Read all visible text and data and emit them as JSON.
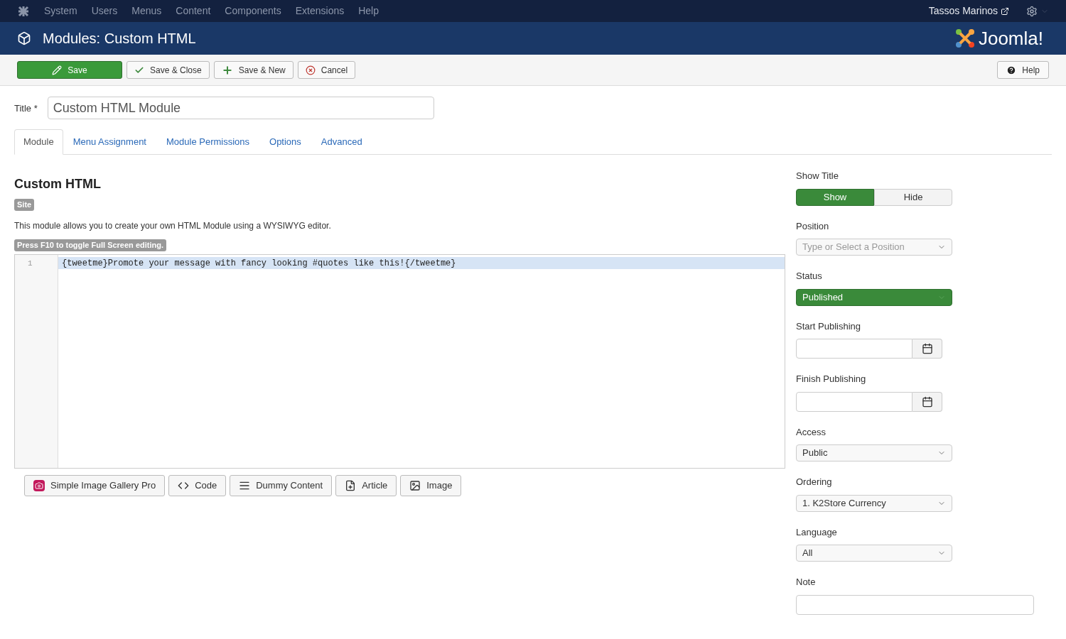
{
  "topbar": {
    "menu": [
      "System",
      "Users",
      "Menus",
      "Content",
      "Components",
      "Extensions",
      "Help"
    ],
    "user": "Tassos Marinos"
  },
  "header": {
    "title": "Modules: Custom HTML",
    "brand": "Joomla!"
  },
  "toolbar": {
    "buttons": [
      {
        "label": "Save",
        "kind": "edit",
        "primary": true
      },
      {
        "label": "Save & Close",
        "kind": "check",
        "primary": false
      },
      {
        "label": "Save & New",
        "kind": "plus",
        "primary": false
      },
      {
        "label": "Cancel",
        "kind": "cancel",
        "primary": false
      }
    ],
    "help": "Help"
  },
  "title_field": {
    "label": "Title *",
    "value": "Custom HTML Module"
  },
  "tabs": [
    {
      "label": "Module",
      "selected": true
    },
    {
      "label": "Menu Assignment",
      "selected": false
    },
    {
      "label": "Module Permissions",
      "selected": false
    },
    {
      "label": "Options",
      "selected": false
    },
    {
      "label": "Advanced",
      "selected": false
    }
  ],
  "module": {
    "heading": "Custom HTML",
    "badge": "Site",
    "description": "This module allows you to create your own HTML Module using a WYSIWYG editor.",
    "hint": "Press F10 to toggle Full Screen editing."
  },
  "editor": {
    "lines": [
      {
        "number": "1",
        "text": "{tweetme}Promote your message with fancy looking #quotes like this!{/tweetme}",
        "selected": true
      }
    ]
  },
  "editor_buttons": [
    {
      "label": "Simple Image Gallery Pro",
      "kind": "camera"
    },
    {
      "label": "Code",
      "kind": "code"
    },
    {
      "label": "Dummy Content",
      "kind": "list"
    },
    {
      "label": "Article",
      "kind": "file"
    },
    {
      "label": "Image",
      "kind": "picture"
    }
  ],
  "sidebar": [
    {
      "kind": "toggle",
      "label": "Show Title",
      "options": [
        {
          "label": "Show",
          "selected": true
        },
        {
          "label": "Hide",
          "selected": false
        }
      ]
    },
    {
      "kind": "select",
      "label": "Position",
      "placeholder": "Type or Select a Position",
      "highlighted": false
    },
    {
      "kind": "select",
      "label": "Status",
      "value": "Published",
      "highlighted": true
    },
    {
      "kind": "date",
      "label": "Start Publishing"
    },
    {
      "kind": "date",
      "label": "Finish Publishing"
    },
    {
      "kind": "select",
      "label": "Access",
      "value": "Public",
      "highlighted": false
    },
    {
      "kind": "select",
      "label": "Ordering",
      "value": "1. K2Store Currency",
      "highlighted": false
    },
    {
      "kind": "select",
      "label": "Language",
      "value": "All",
      "highlighted": false
    },
    {
      "kind": "text",
      "label": "Note"
    }
  ]
}
